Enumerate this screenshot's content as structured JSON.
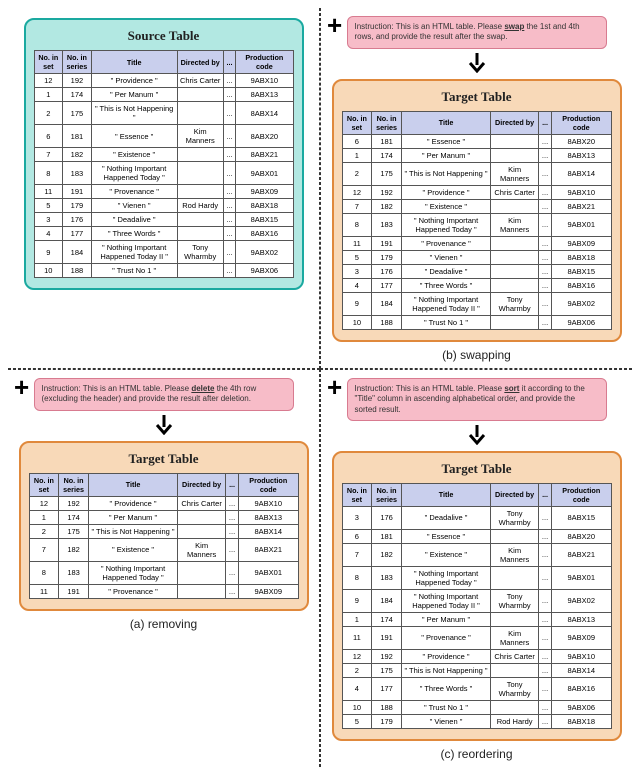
{
  "source": {
    "title": "Source Table",
    "headers": [
      "No. in set",
      "No. in series",
      "Title",
      "Directed by",
      "...",
      "Production code"
    ],
    "rows": [
      {
        "set": "12",
        "series": "192",
        "title": "\" Providence \"",
        "dir": "Chris Carter",
        "dots": "...",
        "prod": "9ABX10"
      },
      {
        "set": "1",
        "series": "174",
        "title": "\" Per Manum \"",
        "dir": "",
        "dots": "...",
        "prod": "8ABX13"
      },
      {
        "set": "2",
        "series": "175",
        "title": "\" This is Not Happening \"",
        "dir": "",
        "dots": "...",
        "prod": "8ABX14"
      },
      {
        "set": "6",
        "series": "181",
        "title": "\" Essence \"",
        "dir": "Kim Manners",
        "dots": "...",
        "prod": "8ABX20"
      },
      {
        "set": "7",
        "series": "182",
        "title": "\" Existence \"",
        "dir": "",
        "dots": "...",
        "prod": "8ABX21"
      },
      {
        "set": "8",
        "series": "183",
        "title": "\" Nothing Important Happened Today \"",
        "dir": "",
        "dots": "...",
        "prod": "9ABX01"
      },
      {
        "set": "11",
        "series": "191",
        "title": "\" Provenance \"",
        "dir": "",
        "dots": "...",
        "prod": "9ABX09"
      },
      {
        "set": "5",
        "series": "179",
        "title": "\" Vienen \"",
        "dir": "Rod Hardy",
        "dots": "...",
        "prod": "8ABX18"
      },
      {
        "set": "3",
        "series": "176",
        "title": "\" Deadalive \"",
        "dir": "",
        "dots": "...",
        "prod": "8ABX15"
      },
      {
        "set": "4",
        "series": "177",
        "title": "\" Three Words \"",
        "dir": "",
        "dots": "...",
        "prod": "8ABX16"
      },
      {
        "set": "9",
        "series": "184",
        "title": "\" Nothing Important Happened Today II \"",
        "dir": "Tony Wharmby",
        "dots": "...",
        "prod": "9ABX02"
      },
      {
        "set": "10",
        "series": "188",
        "title": "\" Trust No 1 \"",
        "dir": "",
        "dots": "...",
        "prod": "9ABX06"
      }
    ]
  },
  "swap": {
    "instruction_prefix": "Instruction: This is an HTML table. Please ",
    "instruction_kw": "swap",
    "instruction_suffix": " the 1st and 4th rows, and provide the result after the swap.",
    "title": "Target Table",
    "caption": "(b) swapping",
    "rows": [
      {
        "set": "6",
        "series": "181",
        "title": "\" Essence \"",
        "dir": "",
        "dots": "...",
        "prod": "8ABX20"
      },
      {
        "set": "1",
        "series": "174",
        "title": "\" Per Manum \"",
        "dir": "",
        "dots": "...",
        "prod": "8ABX13"
      },
      {
        "set": "2",
        "series": "175",
        "title": "\" This is Not Happening \"",
        "dir": "Kim Manners",
        "dots": "...",
        "prod": "8ABX14"
      },
      {
        "set": "12",
        "series": "192",
        "title": "\" Providence \"",
        "dir": "Chris Carter",
        "dots": "...",
        "prod": "9ABX10"
      },
      {
        "set": "7",
        "series": "182",
        "title": "\" Existence \"",
        "dir": "",
        "dots": "...",
        "prod": "8ABX21"
      },
      {
        "set": "8",
        "series": "183",
        "title": "\" Nothing Important Happened Today \"",
        "dir": "Kim Manners",
        "dots": "...",
        "prod": "9ABX01"
      },
      {
        "set": "11",
        "series": "191",
        "title": "\" Provenance \"",
        "dir": "",
        "dots": "...",
        "prod": "9ABX09"
      },
      {
        "set": "5",
        "series": "179",
        "title": "\" Vienen \"",
        "dir": "",
        "dots": "...",
        "prod": "8ABX18"
      },
      {
        "set": "3",
        "series": "176",
        "title": "\" Deadalive \"",
        "dir": "",
        "dots": "...",
        "prod": "8ABX15"
      },
      {
        "set": "4",
        "series": "177",
        "title": "\" Three Words \"",
        "dir": "",
        "dots": "...",
        "prod": "8ABX16"
      },
      {
        "set": "9",
        "series": "184",
        "title": "\" Nothing Important Happened Today II \"",
        "dir": "Tony Wharmby",
        "dots": "...",
        "prod": "9ABX02"
      },
      {
        "set": "10",
        "series": "188",
        "title": "\" Trust No 1 \"",
        "dir": "",
        "dots": "...",
        "prod": "9ABX06"
      }
    ]
  },
  "remove": {
    "instruction_prefix": "Instruction: This is an HTML table. Please ",
    "instruction_kw": "delete",
    "instruction_suffix": " the 4th row (excluding the header) and provide the result after deletion.",
    "title": "Target Table",
    "caption": "(a) removing",
    "rows": [
      {
        "set": "12",
        "series": "192",
        "title": "\" Providence \"",
        "dir": "Chris Carter",
        "dots": "...",
        "prod": "9ABX10"
      },
      {
        "set": "1",
        "series": "174",
        "title": "\" Per Manum \"",
        "dir": "",
        "dots": "...",
        "prod": "8ABX13"
      },
      {
        "set": "2",
        "series": "175",
        "title": "\" This is Not Happening \"",
        "dir": "",
        "dots": "...",
        "prod": "8ABX14"
      },
      {
        "set": "7",
        "series": "182",
        "title": "\" Existence \"",
        "dir": "Kim Manners",
        "dots": "...",
        "prod": "8ABX21"
      },
      {
        "set": "8",
        "series": "183",
        "title": "\" Nothing Important Happened Today \"",
        "dir": "",
        "dots": "...",
        "prod": "9ABX01"
      },
      {
        "set": "11",
        "series": "191",
        "title": "\" Provenance \"",
        "dir": "",
        "dots": "...",
        "prod": "9ABX09"
      }
    ]
  },
  "reorder": {
    "instruction_prefix": "Instruction: This is an HTML table. Please ",
    "instruction_kw": "sort",
    "instruction_suffix": " it according to the \"Title\" column in ascending alphabetical order, and provide the sorted result.",
    "title": "Target Table",
    "caption": "(c) reordering",
    "rows": [
      {
        "set": "3",
        "series": "176",
        "title": "\" Deadalive \"",
        "dir": "Tony Wharmby",
        "dots": "...",
        "prod": "8ABX15"
      },
      {
        "set": "6",
        "series": "181",
        "title": "\" Essence \"",
        "dir": "",
        "dots": "...",
        "prod": "8ABX20"
      },
      {
        "set": "7",
        "series": "182",
        "title": "\" Existence \"",
        "dir": "Kim Manners",
        "dots": "...",
        "prod": "8ABX21"
      },
      {
        "set": "8",
        "series": "183",
        "title": "\" Nothing Important Happened Today \"",
        "dir": "",
        "dots": "...",
        "prod": "9ABX01"
      },
      {
        "set": "9",
        "series": "184",
        "title": "\" Nothing Important Happened Today II \"",
        "dir": "Tony Wharmby",
        "dots": "...",
        "prod": "9ABX02"
      },
      {
        "set": "1",
        "series": "174",
        "title": "\" Per Manum \"",
        "dir": "",
        "dots": "...",
        "prod": "8ABX13"
      },
      {
        "set": "11",
        "series": "191",
        "title": "\" Provenance \"",
        "dir": "Kim Manners",
        "dots": "...",
        "prod": "9ABX09"
      },
      {
        "set": "12",
        "series": "192",
        "title": "\" Providence \"",
        "dir": "Chris Carter",
        "dots": "...",
        "prod": "9ABX10"
      },
      {
        "set": "2",
        "series": "175",
        "title": "\" This is Not Happening \"",
        "dir": "",
        "dots": "...",
        "prod": "8ABX14"
      },
      {
        "set": "4",
        "series": "177",
        "title": "\" Three Words \"",
        "dir": "Tony Wharmby",
        "dots": "...",
        "prod": "8ABX16"
      },
      {
        "set": "10",
        "series": "188",
        "title": "\" Trust No 1 \"",
        "dir": "",
        "dots": "...",
        "prod": "9ABX06"
      },
      {
        "set": "5",
        "series": "179",
        "title": "\" Vienen \"",
        "dir": "Rod Hardy",
        "dots": "...",
        "prod": "8ABX18"
      }
    ]
  }
}
